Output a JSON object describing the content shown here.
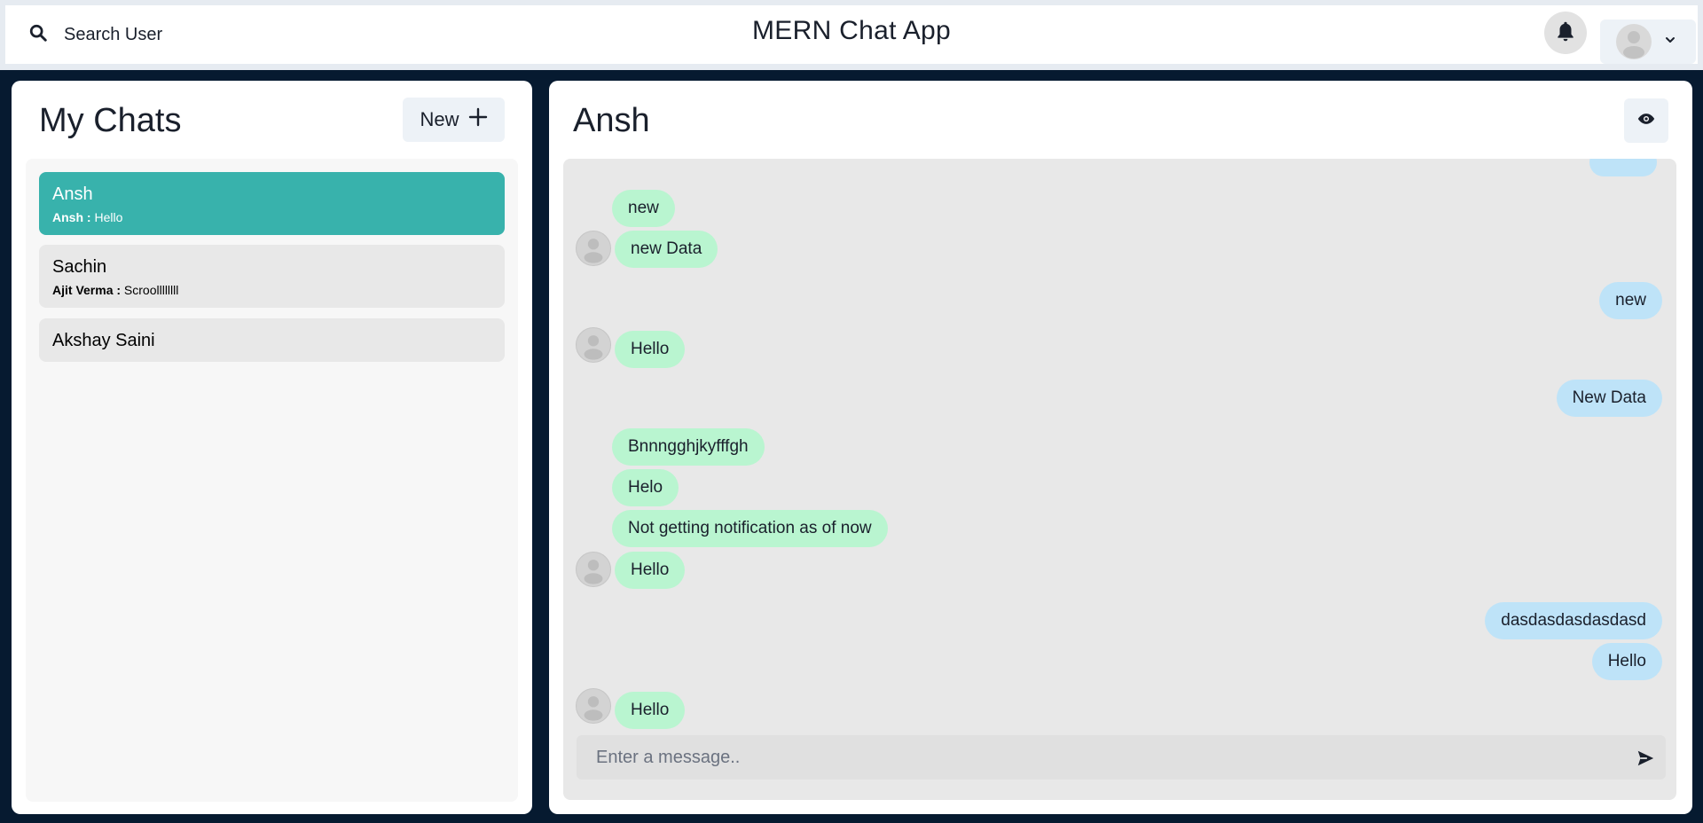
{
  "header": {
    "search_label": "Search User",
    "app_title": "MERN Chat App"
  },
  "sidebar": {
    "title": "My Chats",
    "new_label": "New",
    "chats": [
      {
        "name": "Ansh",
        "sender": "Ansh :",
        "preview": "Hello",
        "active": true
      },
      {
        "name": "Sachin",
        "sender": "Ajit Verma :",
        "preview": "Scroollllllll",
        "active": false
      },
      {
        "name": "Akshay Saini",
        "active": false
      }
    ]
  },
  "chat": {
    "title": "Ansh",
    "input_placeholder": "Enter a message..",
    "messages": [
      {
        "text": "new",
        "direction": "incoming",
        "avatar": false
      },
      {
        "text": "new Data",
        "direction": "incoming",
        "avatar": true
      },
      {
        "text": "new",
        "direction": "outgoing"
      },
      {
        "text": "Hello",
        "direction": "incoming",
        "avatar": true
      },
      {
        "text": "New Data",
        "direction": "outgoing"
      },
      {
        "text": "Bnnngghjkyfffgh",
        "direction": "incoming",
        "avatar": false
      },
      {
        "text": "Helo",
        "direction": "incoming",
        "avatar": false
      },
      {
        "text": "Not getting notification as of now",
        "direction": "incoming",
        "avatar": false
      },
      {
        "text": "Hello",
        "direction": "incoming",
        "avatar": true
      },
      {
        "text": "dasdasdasdasdasd",
        "direction": "outgoing"
      },
      {
        "text": "Hello",
        "direction": "outgoing"
      },
      {
        "text": "Hello",
        "direction": "incoming",
        "avatar": true
      }
    ]
  },
  "colors": {
    "background": "#061a30",
    "active_chat": "#38b2ac",
    "incoming_bubble": "#b9f5d0",
    "outgoing_bubble": "#bee3f8"
  },
  "icons": [
    "search-icon",
    "bell-icon",
    "avatar-icon",
    "chevron-down-icon",
    "plus-icon",
    "eye-icon",
    "send-icon"
  ]
}
